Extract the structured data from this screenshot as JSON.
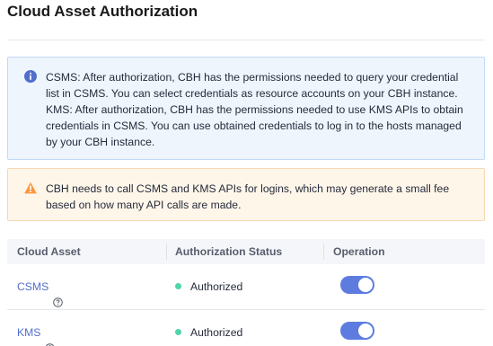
{
  "header": {
    "title": "Cloud Asset Authorization"
  },
  "notices": {
    "info": {
      "icon": "info-circle-icon",
      "color": "#526ecc",
      "lines": [
        "CSMS: After authorization, CBH has the permissions needed to query your credential",
        "list in CSMS. You can select credentials as resource accounts on your CBH instance.",
        "KMS: After authorization, CBH has the permissions needed to use KMS APIs to obtain",
        "credentials in CSMS. You can use obtained credentials to log in to the hosts managed",
        "by your CBH instance."
      ]
    },
    "warning": {
      "icon": "warning-triangle-icon",
      "color": "#fa9841",
      "lines": [
        "CBH needs to call CSMS and KMS APIs for logins, which may generate a small fee",
        "based on how many API calls are made."
      ]
    }
  },
  "table": {
    "columns": [
      "Cloud Asset",
      "Authorization Status",
      "Operation"
    ],
    "rows": [
      {
        "asset": "CSMS",
        "status": "Authorized",
        "enabled": true
      },
      {
        "asset": "KMS",
        "status": "Authorized",
        "enabled": true
      }
    ]
  },
  "colors": {
    "link": "#526ecc",
    "toggle_on": "#5e7ce0",
    "status_authorized": "#50d4ab"
  }
}
